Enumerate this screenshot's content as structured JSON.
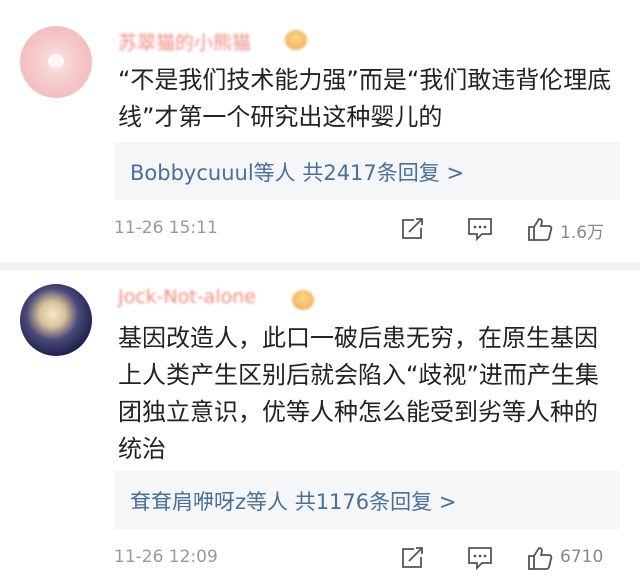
{
  "comments": [
    {
      "username": "苏翠猫的小熊猫",
      "text": "“不是我们技术能力强”而是“我们敢违背伦理底线”才第一个研究出这种婴儿的",
      "reply_summary": "Bobbycuuul等人  共2417条回复 >",
      "time": "11-26 15:11",
      "likes": "1.6万"
    },
    {
      "username": "Jock-Not-alone",
      "text": "基因改造人，此口一破后患无穷，在原生基因上人类产生区别后就会陷入“歧视”进而产生集团独立意识，优等人种怎么能受到劣等人种的统治",
      "reply_summary": "耷耷肩咿呀z等人  共1176条回复 >",
      "time": "11-26 12:09",
      "likes": "6710"
    }
  ],
  "icons": {
    "avatar_1": "avatar",
    "avatar_2": "avatar",
    "vip_badge": "vip-badge-icon",
    "share": "share-icon",
    "reply": "comment-icon",
    "like": "thumbs-up-icon"
  },
  "colors": {
    "username": "#f08a7e",
    "reply_link": "#4a6f9c",
    "meta_text": "#999999",
    "reply_bg": "#f5f6f8",
    "divider": "#f2f2f2"
  }
}
